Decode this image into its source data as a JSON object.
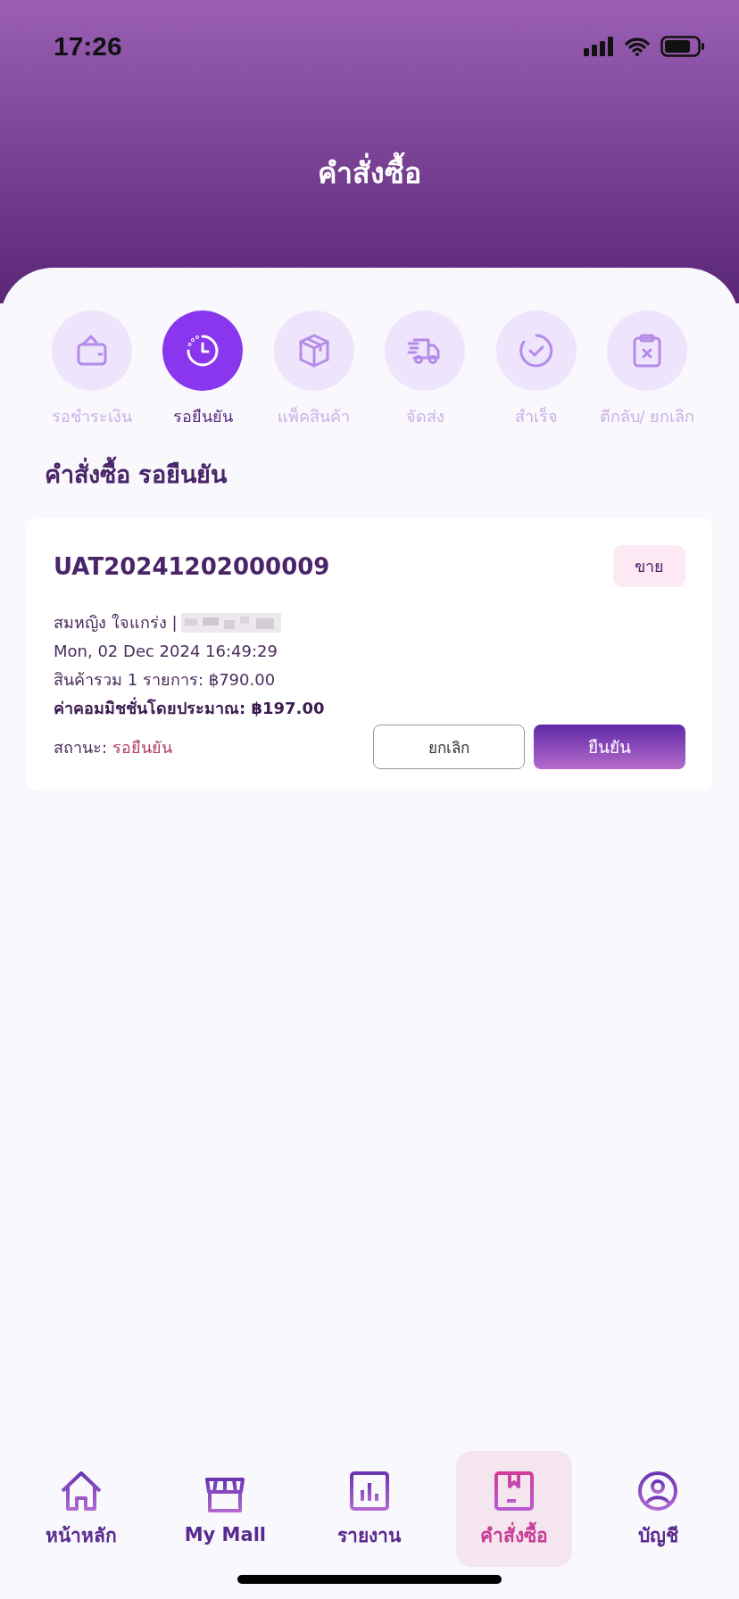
{
  "status_bar": {
    "time": "17:26"
  },
  "header": {
    "title": "คำสั่งซื้อ"
  },
  "steps": [
    {
      "label": "รอชำระเงิน",
      "selected": false
    },
    {
      "label": "รอยืนยัน",
      "selected": true
    },
    {
      "label": "แพ็คสินค้า",
      "selected": false
    },
    {
      "label": "จัดส่ง",
      "selected": false
    },
    {
      "label": "สำเร็จ",
      "selected": false
    },
    {
      "label": "ตีกลับ/ ยกเลิก",
      "selected": false
    }
  ],
  "section_title": "คำสั่งซื้อ รอยืนยัน",
  "orders": [
    {
      "order_id": "UAT20241202000009",
      "tag": "ขาย",
      "customer": "สมหญิง ใจแกร่ง |",
      "date": "Mon, 02 Dec 2024 16:49:29",
      "total": "สินค้ารวม 1 รายการ: ฿790.00",
      "commission": "ค่าคอมมิชชั่นโดยประมาณ: ฿197.00",
      "status_label": "สถานะ:",
      "status": "รอยืนยัน",
      "cancel_button": "ยกเลิก",
      "confirm_button": "ยืนยัน"
    }
  ],
  "bottom_nav": [
    {
      "label": "หน้าหลัก",
      "selected": false
    },
    {
      "label": "My Mall",
      "selected": false
    },
    {
      "label": "รายงาน",
      "selected": false
    },
    {
      "label": "คำสั่งซื้อ",
      "selected": true
    },
    {
      "label": "บัญชี",
      "selected": false
    }
  ]
}
